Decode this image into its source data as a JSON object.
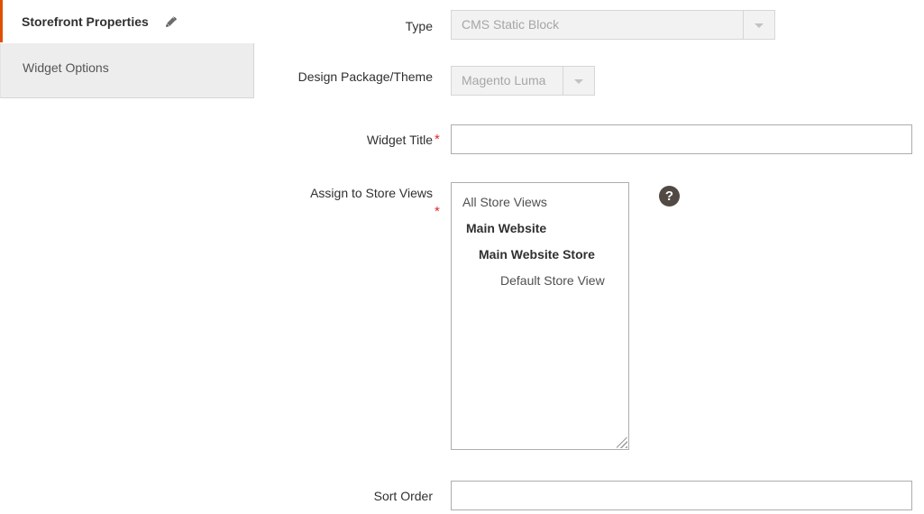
{
  "tabs": [
    {
      "label": "Storefront Properties",
      "state": "active",
      "icon": "pencil-icon"
    },
    {
      "label": "Widget Options",
      "state": "inactive"
    }
  ],
  "form": {
    "fields": [
      {
        "key": "type",
        "label": "Type",
        "required": false,
        "control": "select-disabled",
        "value": "CMS Static Block"
      },
      {
        "key": "design_package_theme",
        "label": "Design Package/Theme",
        "required": false,
        "control": "select-disabled",
        "value": "Magento Luma"
      },
      {
        "key": "widget_title",
        "label": "Widget Title",
        "required": true,
        "control": "text",
        "value": "",
        "placeholder": ""
      },
      {
        "key": "assign_to_store_views",
        "label": "Assign to Store Views",
        "required": true,
        "control": "multiselect",
        "options": [
          {
            "label": "All Store Views",
            "level": 0
          },
          {
            "label": "Main Website",
            "level": 1
          },
          {
            "label": "Main Website Store",
            "level": 2
          },
          {
            "label": "Default Store View",
            "level": 3
          }
        ],
        "help_icon": "question-mark-icon"
      },
      {
        "key": "sort_order",
        "label": "Sort Order",
        "required": false,
        "control": "text",
        "value": "",
        "placeholder": ""
      }
    ],
    "required_marker": "*"
  },
  "colors": {
    "accent_orange": "#e04f00",
    "required_red": "#e02b27",
    "help_icon_bg": "#514943",
    "disabled_text": "#a6a6a6",
    "text": "#303030"
  }
}
